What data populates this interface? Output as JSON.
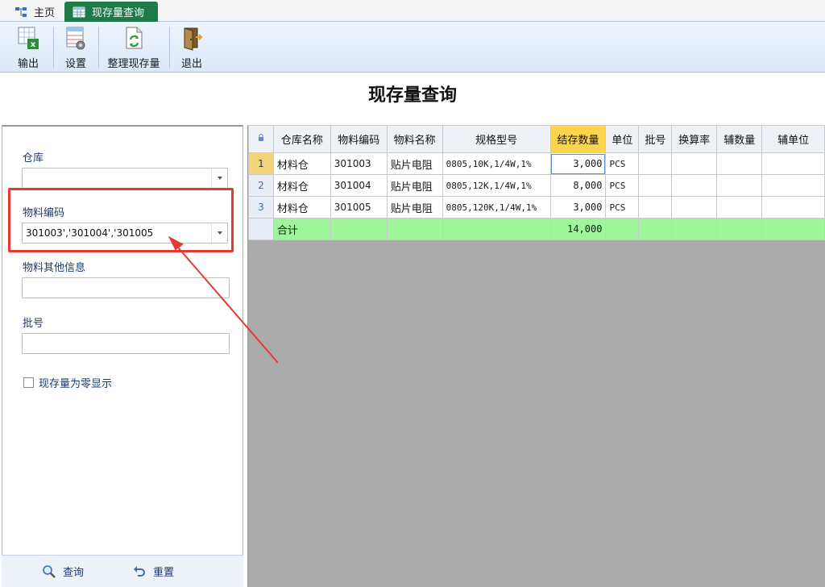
{
  "tabs": [
    {
      "label": "主页",
      "icon": "sitemap-icon"
    },
    {
      "label": "现存量查询",
      "icon": "table-icon",
      "active": true
    }
  ],
  "toolbar": {
    "buttons": [
      {
        "label": "输出",
        "icon": "excel-export-icon"
      },
      {
        "label": "设置",
        "icon": "grid-settings-icon"
      },
      {
        "label": "整理现存量",
        "icon": "refresh-document-icon"
      },
      {
        "label": "退出",
        "icon": "exit-door-icon"
      }
    ]
  },
  "title": "现存量查询",
  "filters": {
    "warehouse_label": "仓库",
    "warehouse_value": "",
    "material_code_label": "物料编码",
    "material_code_value": "301003','301004','301005",
    "material_info_label": "物料其他信息",
    "material_info_value": "",
    "batch_label": "批号",
    "batch_value": "",
    "zero_checkbox_label": "现存量为零显示",
    "zero_checked": false
  },
  "actions": {
    "query_label": "查询",
    "reset_label": "重置"
  },
  "grid": {
    "columns": [
      "仓库名称",
      "物料编码",
      "物料名称",
      "规格型号",
      "结存数量",
      "单位",
      "批号",
      "换算率",
      "辅数量",
      "辅单位"
    ],
    "rows": [
      {
        "n": "1",
        "wh": "材料仓",
        "code": "301003",
        "name": "贴片电阻",
        "spec": "0805,10K,1/4W,1%",
        "qty": "3,000",
        "unit": "PCS"
      },
      {
        "n": "2",
        "wh": "材料仓",
        "code": "301004",
        "name": "贴片电阻",
        "spec": "0805,12K,1/4W,1%",
        "qty": "8,000",
        "unit": "PCS"
      },
      {
        "n": "3",
        "wh": "材料仓",
        "code": "301005",
        "name": "贴片电阻",
        "spec": "0805,120K,1/4W,1%",
        "qty": "3,000",
        "unit": "PCS"
      }
    ],
    "total_label": "合计",
    "total_qty": "14,000"
  },
  "colors": {
    "active_tab": "#1f7a4a",
    "highlight_header": "#ffd44d",
    "total_row": "#9ef59a",
    "annotation": "#e53935"
  }
}
